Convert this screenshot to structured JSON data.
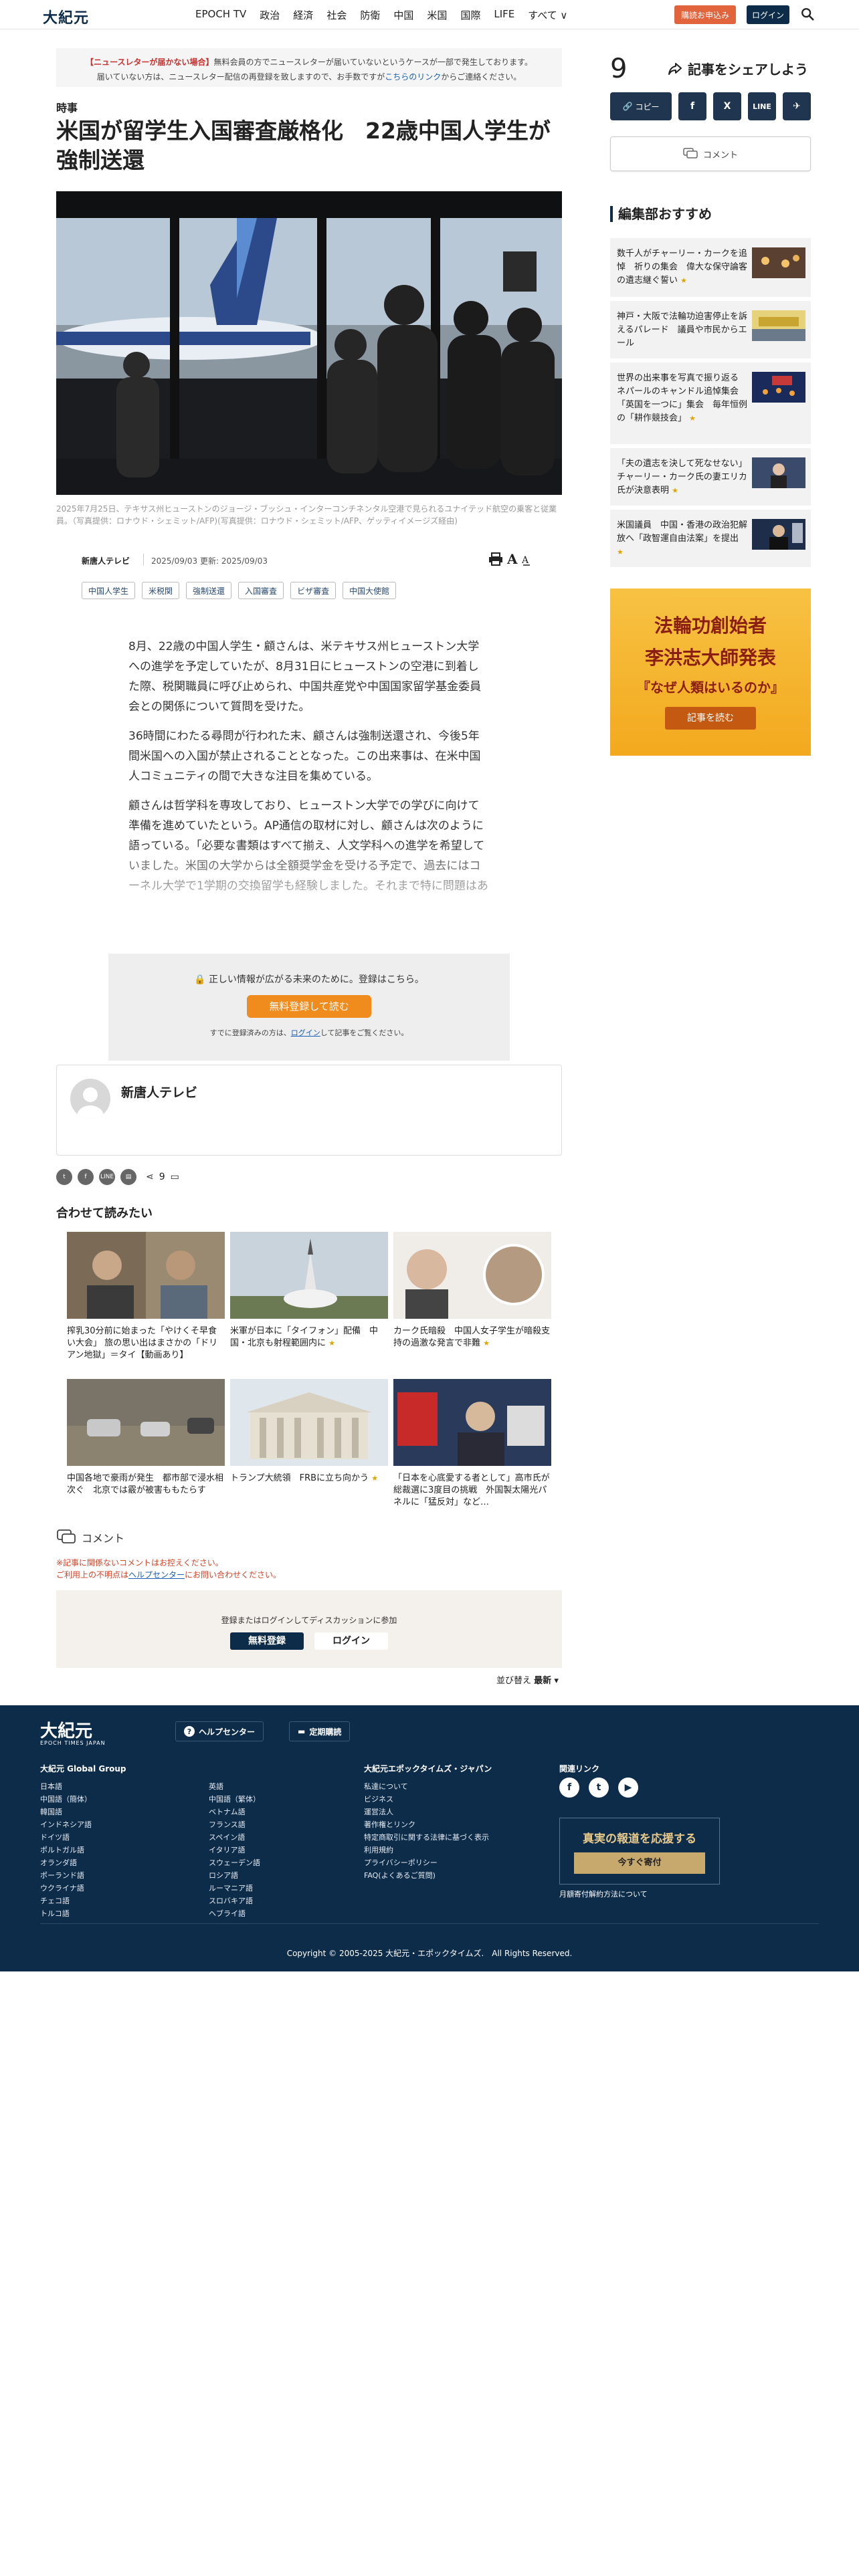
{
  "header": {
    "logo": "大紀元",
    "nav": [
      "EPOCH TV",
      "政治",
      "経済",
      "社会",
      "防衛",
      "中国",
      "米国",
      "国際",
      "LIFE",
      "すべて ∨"
    ],
    "subscribe_label": "購読お申込み",
    "login_label": "ログイン"
  },
  "notice": {
    "highlight": "【ニュースレターが届かない場合】",
    "line1": "無料会員の方でニュースレターが届いていないというケースが一部で発生しております。",
    "line2_a": "届いていない方は、ニュースレター配信の再登録を致しますので、お手数ですが",
    "line2_link": "こちらのリンク",
    "line2_b": "からご連絡ください。"
  },
  "article": {
    "category": "時事",
    "title": "米国が留学生入国審査厳格化　22歳中国人学生が強制送還",
    "caption": "2025年7月25日、テキサス州ヒューストンのジョージ・ブッシュ・インターコンチネンタル空港で見られるユナイテッド航空の乗客と従業員。（写真提供：ロナウド・シェミット/AFP)(写真提供：ロナウド・シェミット/AFP、ゲッティイメージズ経由)",
    "source": "新唐人テレビ",
    "dates": "2025/09/03 更新: 2025/09/03",
    "font_label": "A",
    "tags": [
      "中国人学生",
      "米税関",
      "強制送還",
      "入国審査",
      "ビザ審査",
      "中国大使館"
    ],
    "paragraphs": [
      "8月、22歳の中国人学生・顧さんは、米テキサス州ヒューストン大学への進学を予定していたが、8月31日にヒューストンの空港に到着した際、税関職員に呼び止められ、中国共産党や中国国家留学基金委員会との関係について質問を受けた。",
      "36時間にわたる尋問が行われた末、顧さんは強制送還され、今後5年間米国への入国が禁止されることとなった。この出来事は、在米中国人コミュニティの間で大きな注目を集めている。",
      "顧さんは哲学科を専攻しており、ヒューストン大学での学びに向けて準備を進めていたという。AP通信の取材に対し、顧さんは次のように語っている。「必要な書類はすべて揃え、人文学科への進学を希望していました。米国の大学からは全額奨学金を受ける予定で、過去にはコーネル大学で1学期の交換留学も経験しました。それまで特に問題はありませんでした。」"
    ]
  },
  "paywall": {
    "message": "正しい情報が広がる未来のために。登録はこちら。",
    "register_label": "無料登録して読む",
    "login_prefix": "すでに登録済みの方は、",
    "login_link": "ログイン",
    "login_suffix": "して記事をご覧ください。"
  },
  "author": {
    "name": "新唐人テレビ"
  },
  "share": {
    "count": "9"
  },
  "related": {
    "heading": "合わせて読みたい",
    "items": [
      {
        "title": "搾乳30分前に始まった「やけくそ早食い大会」 旅の思い出はまさかの「ドリアン地獄」＝タイ【動画あり】"
      },
      {
        "title": "米軍が日本に「タイフォン」配備　中国・北京も射程範囲内に"
      },
      {
        "title": "カーク氏暗殺　中国人女子学生が暗殺支持の過激な発言で非難"
      },
      {
        "title": "中国各地で豪雨が発生　都市部で浸水相次ぐ　北京では霰が被害ももたらす"
      },
      {
        "title": "トランプ大統領　FRBに立ち向かう"
      },
      {
        "title": "「日本を心底愛する者として」高市氏が総裁選に3度目の挑戦　外国製太陽光パネルに「猛反対」など…"
      }
    ]
  },
  "comments": {
    "label": "コメント",
    "warn1": "※記事に関係ないコメントはお控えください。",
    "warn2_a": "ご利用上の不明点は",
    "warn2_link": "ヘルプセンター",
    "warn2_b": "にお問い合わせください。",
    "discuss_message": "登録またはログインしてディスカッションに参加",
    "register_label": "無料登録",
    "login_label": "ログイン",
    "sort_label": "並び替え",
    "sort_value": "最新"
  },
  "sidebar": {
    "share_count": "9",
    "share_label": "記事をシェアしよう",
    "copy_label": "コピー",
    "social": [
      "f",
      "X",
      "LINE",
      "✈"
    ],
    "comment_label": "コメント",
    "rec_heading": "編集部おすすめ",
    "rec_items": [
      {
        "title": "数千人がチャーリー・カークを追悼　祈りの集会　偉大な保守論客の遺志継ぐ誓い"
      },
      {
        "title": "神戸・大阪で法輪功迫害停止を訴えるパレード　議員や市民からエール"
      },
      {
        "title": "世界の出来事を写真で振り返る　ネパールのキャンドル追悼集会 「英国を一つに」集会　毎年恒例の「耕作競技会」"
      },
      {
        "title": "「夫の遺志を決して死なせない」チャーリー・カーク氏の妻エリカ氏が決意表明"
      },
      {
        "title": "米国議員　中国・香港の政治犯解放へ「政智運自由法案」を提出"
      }
    ],
    "ad": {
      "line1": "法輪功創始者",
      "line2": "李洪志大師発表",
      "line3": "『なぜ人類はいるのか』",
      "button": "記事を読む"
    }
  },
  "footer": {
    "logo": "大紀元",
    "logo_sub": "EPOCH TIMES JAPAN",
    "help_label": "ヘルプセンター",
    "subscribe_label": "定期購読",
    "group_heading": "大紀元 Global Group",
    "group_col1": [
      "日本語",
      "中国語（簡体）",
      "韓国語",
      "インドネシア語",
      "ドイツ語",
      "ポルトガル語",
      "オランダ語",
      "ポーランド語",
      "ウクライナ語",
      "チェコ語",
      "トルコ語"
    ],
    "group_col2": [
      "英語",
      "中国語（繁体）",
      "ベトナム語",
      "フランス語",
      "スペイン語",
      "イタリア語",
      "スウェーデン語",
      "ロシア語",
      "ルーマニア語",
      "スロバキア語",
      "ヘブライ語"
    ],
    "company_heading": "大紀元エポックタイムズ・ジャパン",
    "company_links": [
      "私達について",
      "ビジネス",
      "運営法人",
      "著作権とリンク",
      "特定商取引に関する法律に基づく表示",
      "利用規約",
      "プライバシーポリシー",
      "FAQ(よくあるご質問)"
    ],
    "related_heading": "関連リンク",
    "support_title": "真実の報道を応援する",
    "support_button": "今すぐ寄付",
    "monthly_label": "月額寄付解約方法について",
    "copyright": "Copyright © 2005-2025 大紀元・エポックタイムズ.　All Rights Reserved."
  }
}
